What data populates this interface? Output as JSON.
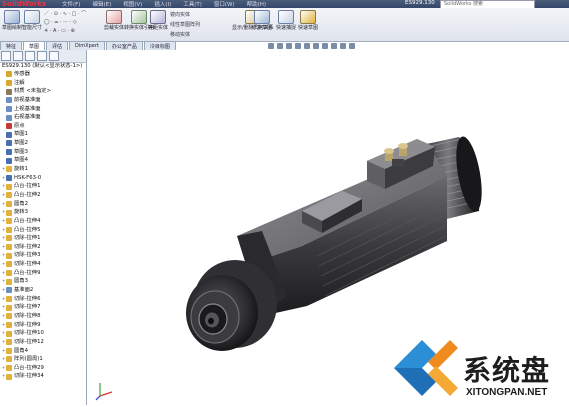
{
  "titlebar": {
    "logo": "SolidWorks",
    "menu": [
      "文件(F)",
      "编辑(E)",
      "视图(V)",
      "插入(I)",
      "工具(T)",
      "窗口(W)",
      "帮助(H)"
    ],
    "document": "ES929.130",
    "search_placeholder": "SolidWorks 搜索"
  },
  "ribbon": {
    "buttons": [
      {
        "label": "草图绘制"
      },
      {
        "label": "智能尺寸"
      },
      {
        "label": "剪裁实体"
      },
      {
        "label": "转换实体引用"
      },
      {
        "label": "等距实体"
      },
      {
        "label": "镜向实体"
      },
      {
        "label": "线性草图阵列"
      },
      {
        "label": "移动实体"
      },
      {
        "label": "显示/删除几何关系"
      },
      {
        "label": "修复草图"
      },
      {
        "label": "快速捕捉"
      },
      {
        "label": "快速草图"
      }
    ]
  },
  "tabs": [
    "特征",
    "草图",
    "评估",
    "DimXpert",
    "办公室产品",
    "冷目标图"
  ],
  "active_tab": "草图",
  "tree": {
    "root": "ES929.130  (默认<显示状态-1>)",
    "items": [
      {
        "label": "传感器",
        "color": "#d9a62e"
      },
      {
        "label": "注解",
        "color": "#d9a62e"
      },
      {
        "label": "材质 <未指定>",
        "color": "#8a7a5a"
      },
      {
        "label": "前视基准面",
        "color": "#6b8fc4"
      },
      {
        "label": "上视基准面",
        "color": "#6b8fc4"
      },
      {
        "label": "右视基准面",
        "color": "#6b8fc4"
      },
      {
        "label": "原点",
        "color": "#c43a3a"
      },
      {
        "label": "草图1",
        "color": "#4a6fb0"
      },
      {
        "label": "草图2",
        "color": "#4a6fb0"
      },
      {
        "label": "草图3",
        "color": "#4a6fb0"
      },
      {
        "label": "草图4",
        "color": "#4a6fb0"
      },
      {
        "label": "旋转1",
        "color": "#e0b23a"
      },
      {
        "label": "HSK-F63-0",
        "color": "#4a6fb0"
      },
      {
        "label": "凸台-拉伸1",
        "color": "#e0b23a"
      },
      {
        "label": "凸台-拉伸2",
        "color": "#e0b23a"
      },
      {
        "label": "圆角2",
        "color": "#e0b23a"
      },
      {
        "label": "旋转3",
        "color": "#e0b23a"
      },
      {
        "label": "凸台-拉伸4",
        "color": "#e0b23a"
      },
      {
        "label": "凸台-拉伸5",
        "color": "#e0b23a"
      },
      {
        "label": "切除-拉伸1",
        "color": "#e0b23a"
      },
      {
        "label": "切除-拉伸2",
        "color": "#e0b23a"
      },
      {
        "label": "切除-拉伸3",
        "color": "#e0b23a"
      },
      {
        "label": "切除-拉伸4",
        "color": "#e0b23a"
      },
      {
        "label": "凸台-拉伸9",
        "color": "#e0b23a"
      },
      {
        "label": "圆角3",
        "color": "#e0b23a"
      },
      {
        "label": "基准面2",
        "color": "#6b8fc4"
      },
      {
        "label": "切除-拉伸6",
        "color": "#e0b23a"
      },
      {
        "label": "切除-拉伸7",
        "color": "#e0b23a"
      },
      {
        "label": "切除-拉伸8",
        "color": "#e0b23a"
      },
      {
        "label": "切除-拉伸9",
        "color": "#e0b23a"
      },
      {
        "label": "切除-拉伸10",
        "color": "#e0b23a"
      },
      {
        "label": "切除-拉伸12",
        "color": "#e0b23a"
      },
      {
        "label": "圆角4",
        "color": "#e0b23a"
      },
      {
        "label": "阵列(圆周)1",
        "color": "#e0b23a"
      },
      {
        "label": "凸台-拉伸29",
        "color": "#e0b23a"
      },
      {
        "label": "切除-拉伸34",
        "color": "#e0b23a"
      }
    ]
  },
  "watermark": {
    "brand": "系统盘",
    "url": "XITONGPAN.NET"
  }
}
